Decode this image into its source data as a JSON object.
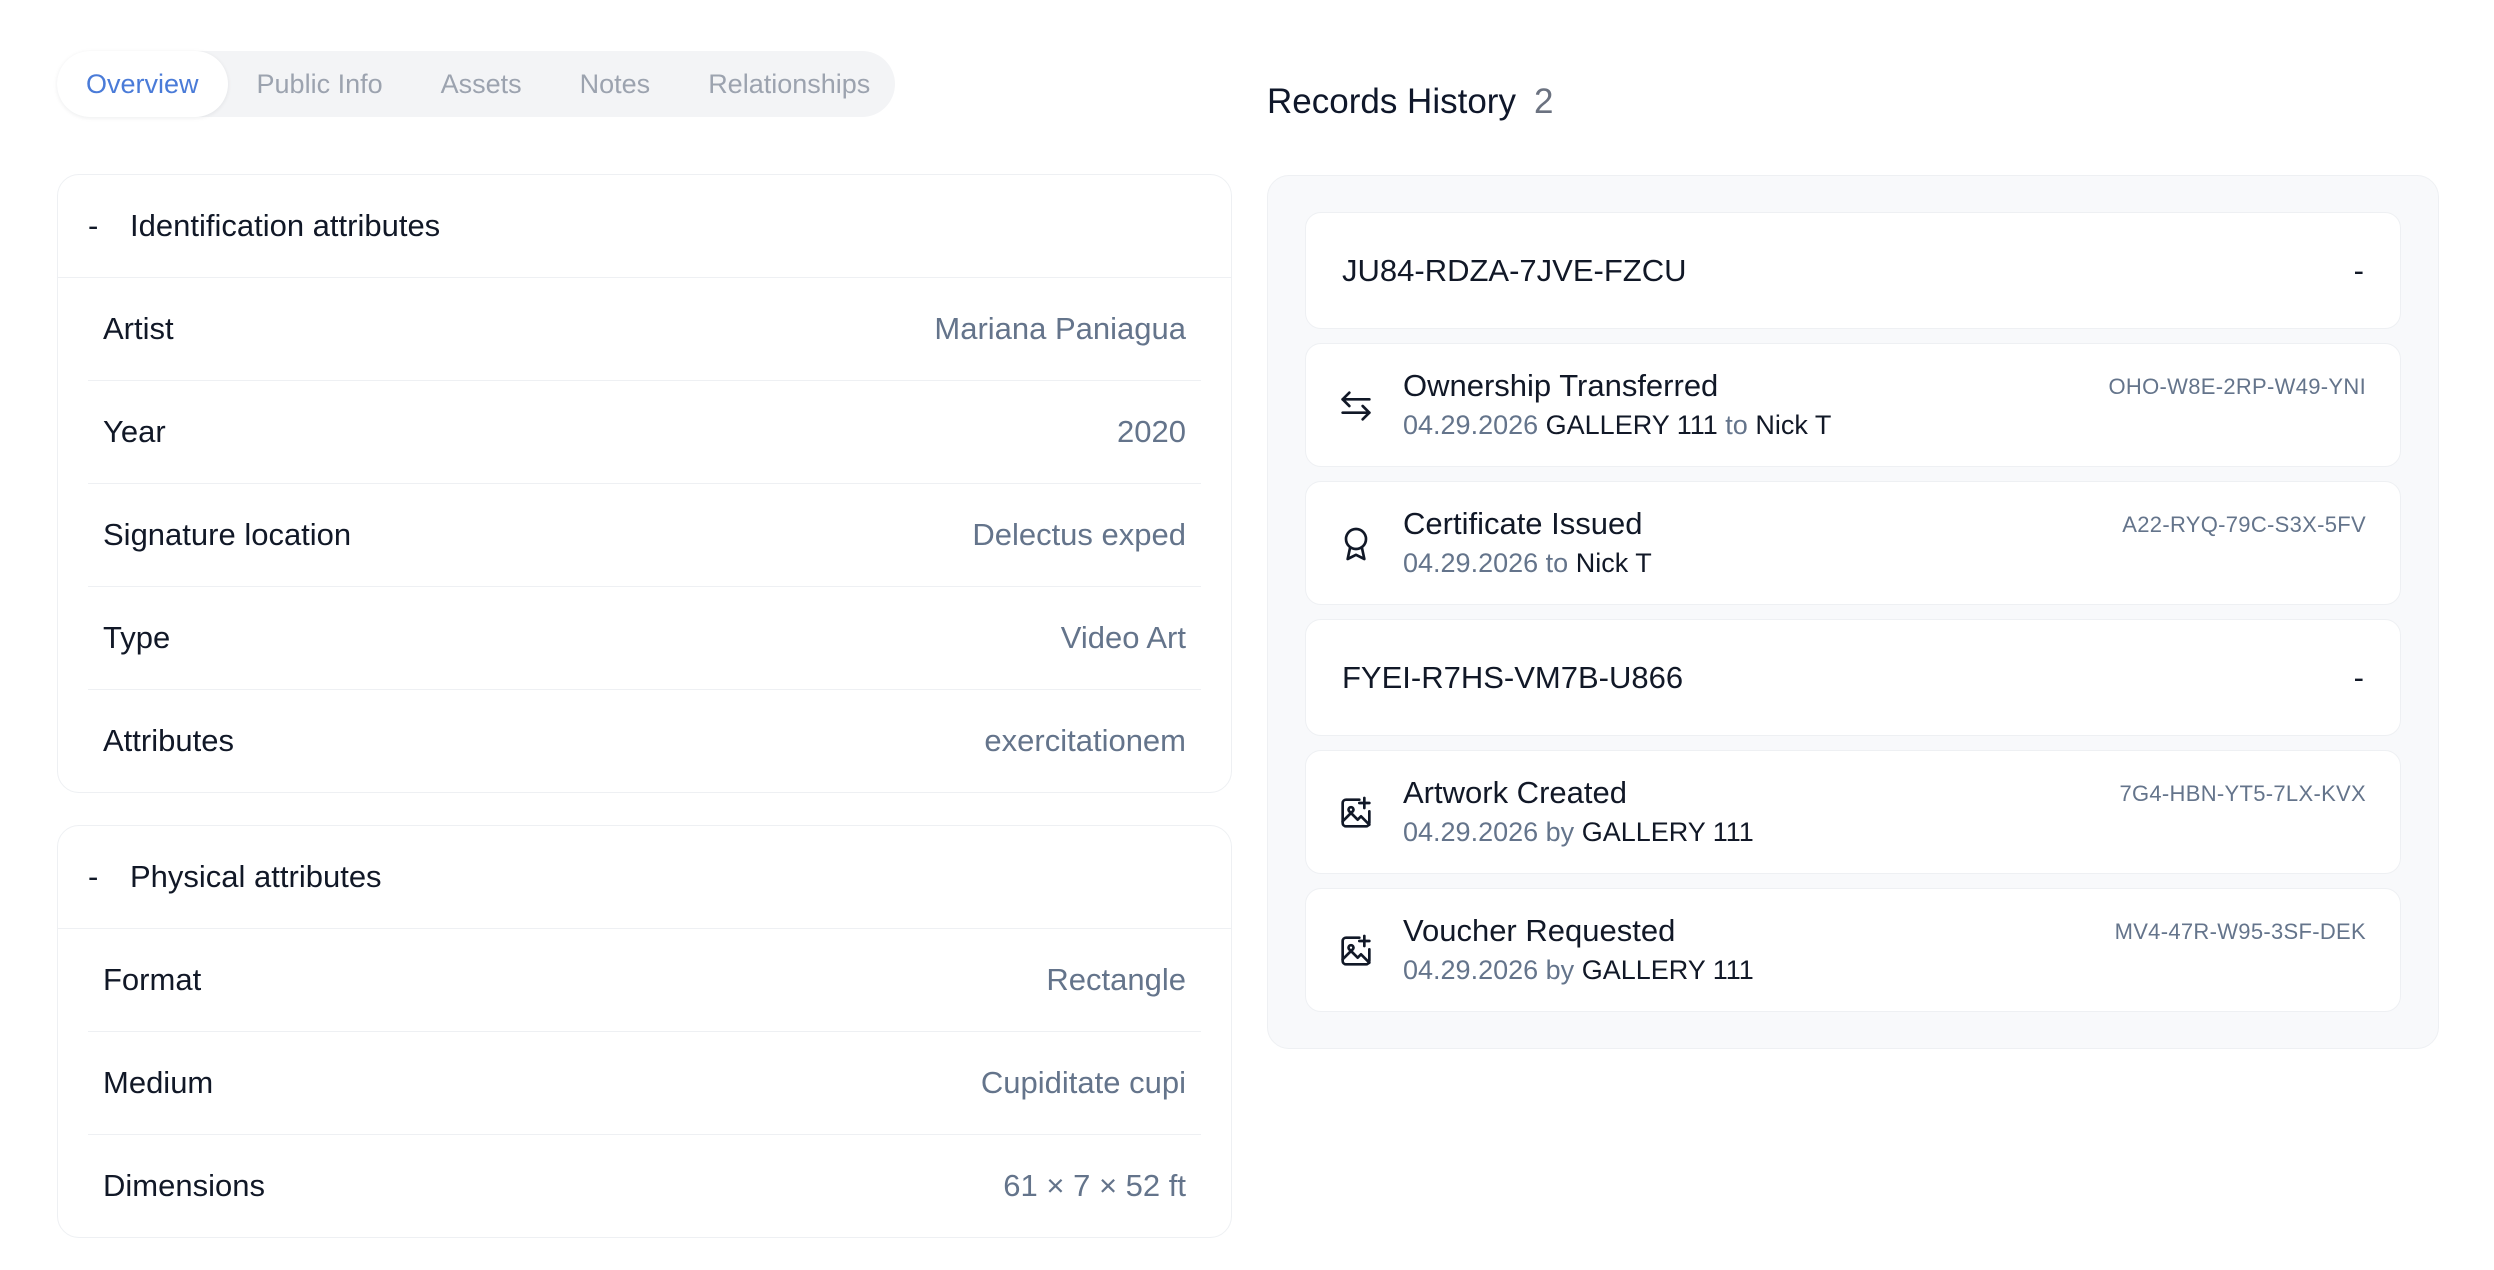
{
  "tabs": [
    {
      "label": "Overview",
      "active": true
    },
    {
      "label": "Public Info",
      "active": false
    },
    {
      "label": "Assets",
      "active": false
    },
    {
      "label": "Notes",
      "active": false
    },
    {
      "label": "Relationships",
      "active": false
    }
  ],
  "identification": {
    "toggle": "-",
    "title": "Identification attributes",
    "rows": [
      {
        "label": "Artist",
        "value": "Mariana Paniagua"
      },
      {
        "label": "Year",
        "value": "2020"
      },
      {
        "label": "Signature location",
        "value": "Delectus exped"
      },
      {
        "label": "Type",
        "value": "Video Art"
      },
      {
        "label": "Attributes",
        "value": "exercitationem"
      }
    ]
  },
  "physical": {
    "toggle": "-",
    "title": "Physical attributes",
    "rows": [
      {
        "label": "Format",
        "value": "Rectangle"
      },
      {
        "label": "Medium",
        "value": "Cupiditate cupi"
      },
      {
        "label": "Dimensions",
        "value": "61 × 7 × 52 ft"
      }
    ]
  },
  "records_history": {
    "title": "Records History",
    "count": "2",
    "groups": [
      {
        "id": "JU84-RDZA-7JVE-FZCU",
        "toggle": "-",
        "events": [
          {
            "icon": "transfer-arrows-icon",
            "title": "Ownership Transferred",
            "date": "04.29.2026",
            "from": "GALLERY 111",
            "connector": "to",
            "to": "Nick T",
            "code": "OHO-W8E-2RP-W49-YNI"
          },
          {
            "icon": "certificate-badge-icon",
            "title": "Certificate Issued",
            "date": "04.29.2026",
            "connector": "to",
            "to": "Nick T",
            "code": "A22-RYQ-79C-S3X-5FV"
          }
        ]
      },
      {
        "id": "FYEI-R7HS-VM7B-U866",
        "toggle": "-",
        "events": [
          {
            "icon": "image-plus-icon",
            "title": "Artwork Created",
            "date": "04.29.2026",
            "connector": "by",
            "to": "GALLERY 111",
            "code": "7G4-HBN-YT5-7LX-KVX"
          },
          {
            "icon": "image-plus-icon",
            "title": "Voucher Requested",
            "date": "04.29.2026",
            "connector": "by",
            "to": "GALLERY 111",
            "code": "MV4-47R-W95-3SF-DEK"
          }
        ]
      }
    ]
  },
  "colors": {
    "accent": "#4a7bd8",
    "muted_text": "#64748b",
    "border": "#eef0f3"
  }
}
